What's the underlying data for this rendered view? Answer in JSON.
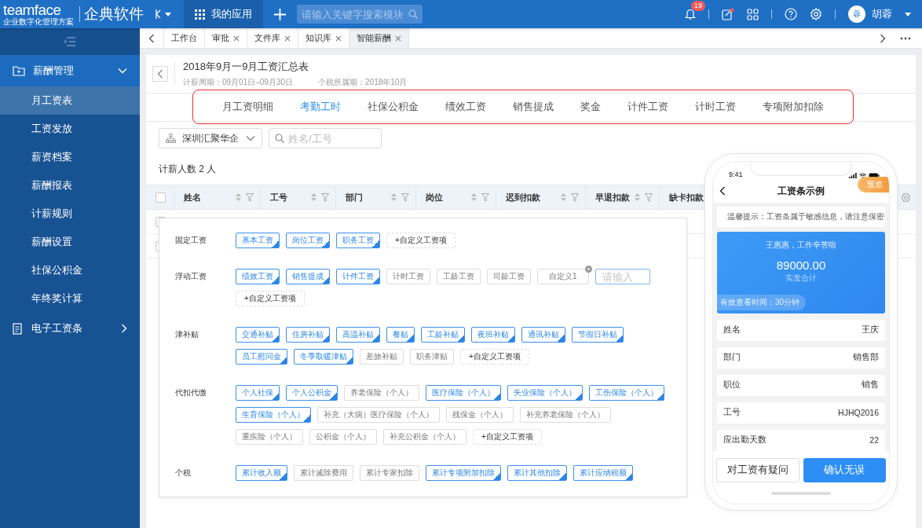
{
  "topbar": {
    "logo": "teamface",
    "logo_tagline": "企业数字化管理方案",
    "brand": "企典软件",
    "apps_tab": "我的应用",
    "search": {
      "placeholder": "请输入关键字搜索模块"
    },
    "notification_count": "19",
    "avatar": "蓉",
    "user": "胡蓉"
  },
  "sidebar": {
    "items": [
      {
        "label": "薪酬管理",
        "expanded": true,
        "children": [
          {
            "label": "月工资表",
            "selected": true
          },
          {
            "label": "工资发放",
            "selected": false
          },
          {
            "label": "薪资档案",
            "selected": false
          },
          {
            "label": "薪酬报表",
            "selected": false
          },
          {
            "label": "计薪规则",
            "selected": false
          },
          {
            "label": "薪酬设置",
            "selected": false
          },
          {
            "label": "社保公积金",
            "selected": false
          },
          {
            "label": "年终奖计算",
            "selected": false
          }
        ]
      },
      {
        "label": "电子工资条",
        "expanded": false
      }
    ]
  },
  "tabs": [
    {
      "label": "工作台",
      "closable": false,
      "selected": false
    },
    {
      "label": "审批",
      "closable": true,
      "selected": false
    },
    {
      "label": "文件库",
      "closable": true,
      "selected": false
    },
    {
      "label": "知识库",
      "closable": true,
      "selected": false
    },
    {
      "label": "智能薪酬",
      "closable": true,
      "selected": true
    }
  ],
  "page": {
    "title": "2018年9月一9月工资汇总表",
    "pay_period": "计薪周期：09月01日–09月30日",
    "tax_period": "个税所属期：2018年10月"
  },
  "category_tabs": [
    {
      "label": "月工资明细",
      "selected": false
    },
    {
      "label": "考勤工时",
      "selected": true
    },
    {
      "label": "社保公积金",
      "selected": false
    },
    {
      "label": "绩效工资",
      "selected": false
    },
    {
      "label": "销售提成",
      "selected": false
    },
    {
      "label": "奖金",
      "selected": false
    },
    {
      "label": "计件工资",
      "selected": false
    },
    {
      "label": "计时工资",
      "selected": false
    },
    {
      "label": "专项附加扣除",
      "selected": false
    }
  ],
  "filters": {
    "department": "深圳汇聚华企",
    "search": {
      "placeholder": "姓名/工号"
    }
  },
  "headcount": "计薪人数 2 人",
  "table": {
    "header_checked": false,
    "columns": [
      {
        "label": "姓名"
      },
      {
        "label": "工号"
      },
      {
        "label": "部门"
      },
      {
        "label": "岗位"
      },
      {
        "label": "迟到扣款"
      },
      {
        "label": "早退扣款"
      },
      {
        "label": "缺卡扣款"
      }
    ],
    "rows": [
      {
        "checked": false
      },
      {
        "checked": false
      }
    ]
  },
  "salary_items_panel": {
    "sections": [
      {
        "label": "固定工资",
        "items": [
          {
            "kind": "chip",
            "label": "基本工资",
            "selected": true
          },
          {
            "kind": "chip",
            "label": "岗位工资",
            "selected": true
          },
          {
            "kind": "chip",
            "label": "职务工资",
            "selected": true
          },
          {
            "kind": "add",
            "label": "+自定义工资项"
          }
        ]
      },
      {
        "label": "浮动工资",
        "items": [
          {
            "kind": "chip",
            "label": "绩效工资",
            "selected": true
          },
          {
            "kind": "chip",
            "label": "销售提成",
            "selected": true
          },
          {
            "kind": "chip",
            "label": "计件工资",
            "selected": true
          },
          {
            "kind": "chip",
            "label": "计时工资",
            "selected": false
          },
          {
            "kind": "chip",
            "label": "工龄工资",
            "selected": false
          },
          {
            "kind": "chip",
            "label": "司龄工资",
            "selected": false
          },
          {
            "kind": "custom",
            "label": "自定义1"
          },
          {
            "kind": "input",
            "placeholder": "请输入"
          },
          {
            "kind": "add",
            "label": "+自定义工资项"
          }
        ]
      },
      {
        "label": "津补贴",
        "items": [
          {
            "kind": "chip",
            "label": "交通补贴",
            "selected": true
          },
          {
            "kind": "chip",
            "label": "住房补贴",
            "selected": true
          },
          {
            "kind": "chip",
            "label": "高温补贴",
            "selected": true
          },
          {
            "kind": "chip",
            "label": "餐贴",
            "selected": true
          },
          {
            "kind": "chip",
            "label": "工龄补贴",
            "selected": true
          },
          {
            "kind": "chip",
            "label": "夜班补贴",
            "selected": true
          },
          {
            "kind": "chip",
            "label": "通讯补贴",
            "selected": true
          },
          {
            "kind": "chip",
            "label": "节假日补贴",
            "selected": true
          },
          {
            "kind": "chip",
            "label": "员工慰问金",
            "selected": true
          },
          {
            "kind": "chip",
            "label": "冬季取暖津贴",
            "selected": true
          },
          {
            "kind": "chip",
            "label": "差旅补贴",
            "selected": false
          },
          {
            "kind": "chip",
            "label": "职务津贴",
            "selected": false
          },
          {
            "kind": "add",
            "label": "+自定义工资项"
          }
        ]
      },
      {
        "label": "代扣代缴",
        "items": [
          {
            "kind": "chip",
            "label": "个人社保",
            "selected": true
          },
          {
            "kind": "chip",
            "label": "个人公积金",
            "selected": true
          },
          {
            "kind": "chip",
            "label": "养老保险（个人）",
            "selected": false
          },
          {
            "kind": "chip",
            "label": "医疗保险（个人）",
            "selected": true
          },
          {
            "kind": "chip",
            "label": "失业保险（个人）",
            "selected": true
          },
          {
            "kind": "chip",
            "label": "工伤保险（个人）",
            "selected": true
          },
          {
            "kind": "chip",
            "label": "生育保险（个人）",
            "selected": true
          },
          {
            "kind": "chip",
            "label": "补充（大病）医疗保险（个人）",
            "selected": false
          },
          {
            "kind": "chip",
            "label": "残保金（个人）",
            "selected": false
          },
          {
            "kind": "chip",
            "label": "补充养老保险（个人）",
            "selected": false
          },
          {
            "kind": "chip",
            "label": "重疾险（个人）",
            "selected": false
          },
          {
            "kind": "chip",
            "label": "公积金（个人）",
            "selected": false
          },
          {
            "kind": "chip",
            "label": "补充公积金（个人）",
            "selected": false
          },
          {
            "kind": "add",
            "label": "+自定义工资项"
          }
        ]
      },
      {
        "label": "个税",
        "items": [
          {
            "kind": "chip",
            "label": "累计收入额",
            "selected": true
          },
          {
            "kind": "chip",
            "label": "累计减除费用",
            "selected": false
          },
          {
            "kind": "chip",
            "label": "累计专家扣除",
            "selected": false
          },
          {
            "kind": "chip",
            "label": "累计专项附加扣除",
            "selected": true
          },
          {
            "kind": "chip",
            "label": "累计其他扣除",
            "selected": true
          },
          {
            "kind": "chip",
            "label": "累计应纳税额",
            "selected": true
          }
        ]
      }
    ]
  },
  "payslip_preview": {
    "time": "9:41",
    "title": "工资条示例",
    "preview_badge": "预览",
    "notice": "温馨提示：工资条属于敏感信息，请注意保密",
    "greeting": "王惠惠，工作辛苦啦",
    "amount": "89000.00",
    "amount_label": "实发合计",
    "validity": "有效查看时间：30分钟",
    "fields": [
      {
        "label": "姓名",
        "value": "王庆"
      },
      {
        "label": "部门",
        "value": "销售部"
      },
      {
        "label": "职位",
        "value": "销售"
      },
      {
        "label": "工号",
        "value": "HJHQ2016"
      },
      {
        "label": "应出勤天数",
        "value": "22"
      }
    ],
    "buttons": [
      {
        "label": "对工资有疑问",
        "kind": "secondary"
      },
      {
        "label": "确认无误",
        "kind": "primary"
      }
    ]
  }
}
